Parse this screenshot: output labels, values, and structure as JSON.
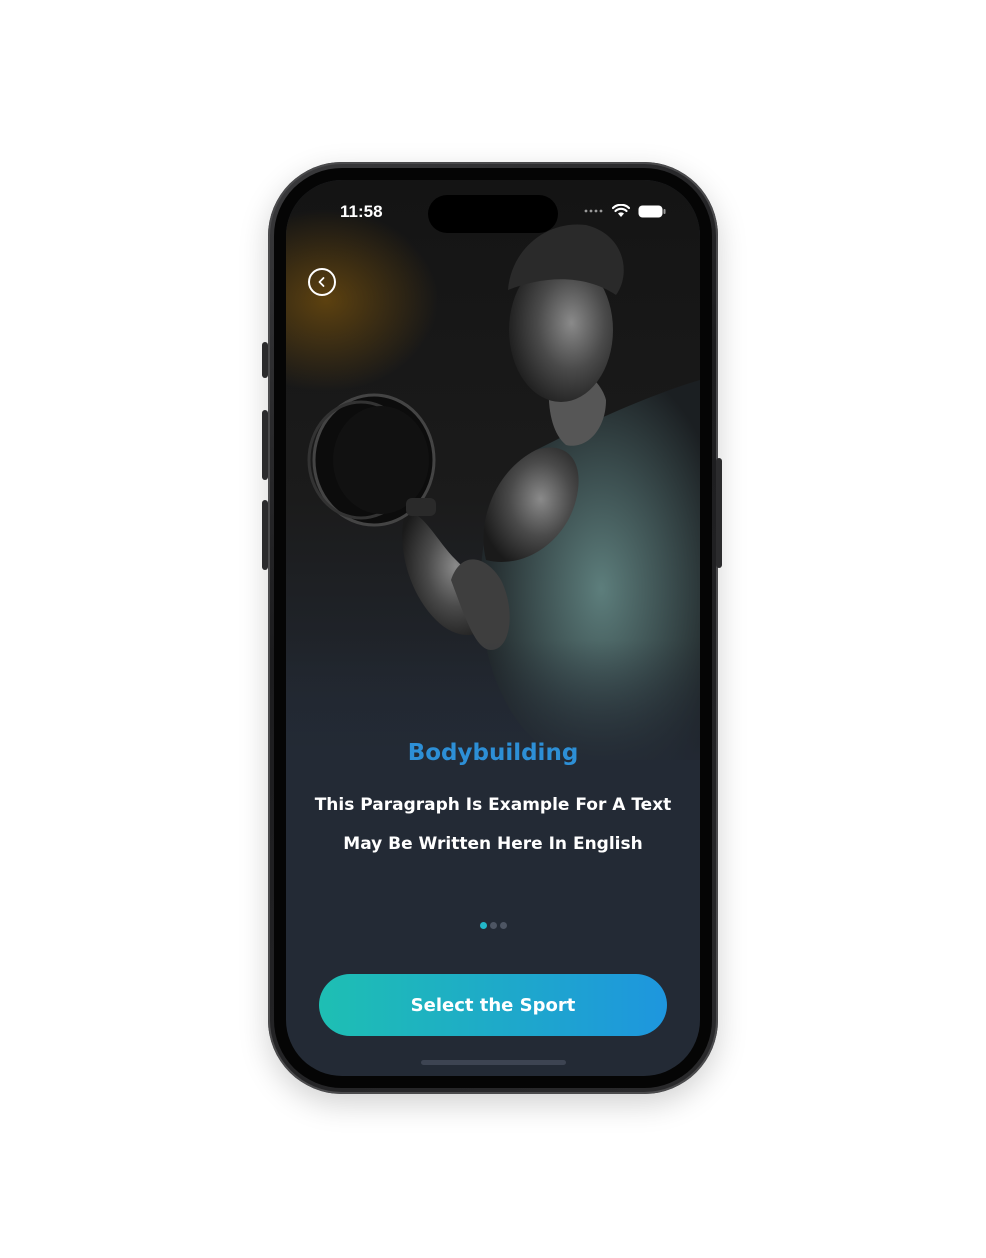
{
  "status_bar": {
    "time": "11:58",
    "signal_icon": "signal-dots-icon",
    "wifi_icon": "wifi-icon",
    "battery_icon": "battery-icon"
  },
  "header": {
    "back_icon": "chevron-left-circle-icon"
  },
  "hero": {
    "image": "bodybuilder-dumbbell-photo"
  },
  "content": {
    "title": "Bodybuilding",
    "paragraph_line1": "This Paragraph Is Example For A Text",
    "paragraph_line2": "May Be Written Here In English"
  },
  "pager": {
    "total": 3,
    "active_index": 0
  },
  "cta": {
    "label": "Select the Sport"
  },
  "colors": {
    "background": "#232a35",
    "title": "#2d8fd6",
    "button_start": "#1ebfb3",
    "button_end": "#1e96de",
    "dot_active": "#22b7c9",
    "dot_inactive": "#4d5563"
  }
}
